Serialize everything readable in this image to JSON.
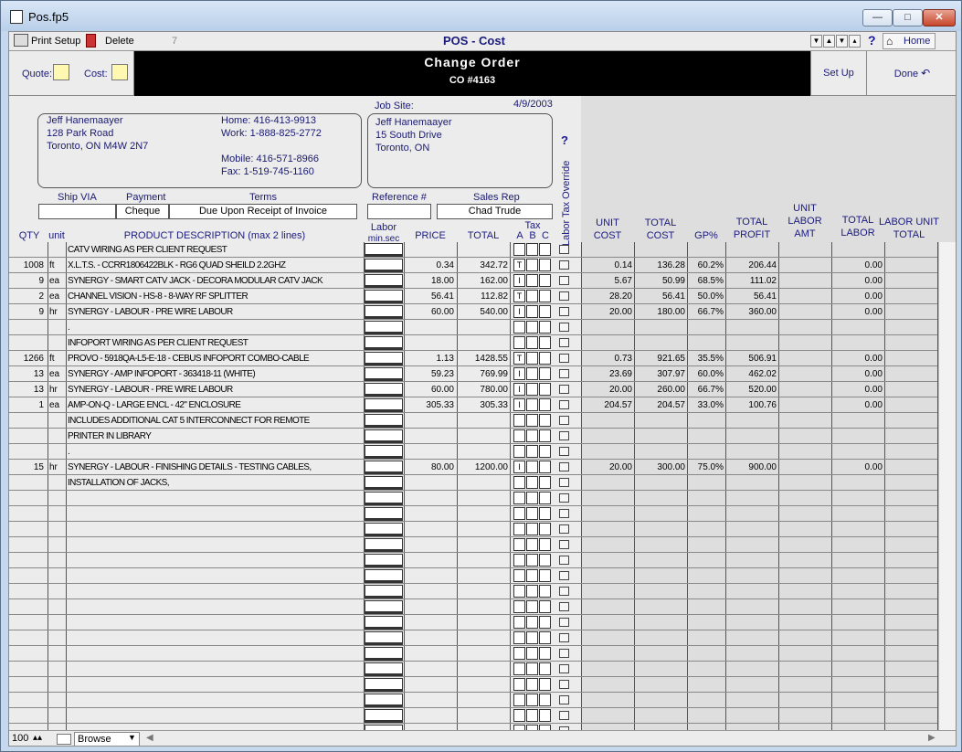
{
  "window": {
    "title": "Pos.fp5"
  },
  "toolbar": {
    "print_setup": "Print Setup",
    "delete": "Delete",
    "record_number": "7",
    "layout_title": "POS - Cost",
    "help": "?",
    "home": "Home"
  },
  "header": {
    "quote_label": "Quote:",
    "cost_label": "Cost:",
    "title": "Change Order",
    "co_number": "CO #4163",
    "setup": "Set Up",
    "done": "Done"
  },
  "customer": {
    "name": "Jeff Hanemaayer",
    "address1": "128 Park Road",
    "address2": "Toronto, ON M4W 2N7",
    "home": "Home: 416-413-9913",
    "work": "Work: 1-888-825-2772",
    "mobile": "Mobile: 416-571-8966",
    "fax": "Fax: 1-519-745-1160"
  },
  "job_site": {
    "label": "Job Site:",
    "date": "4/9/2003",
    "name": "Jeff Hanemaayer",
    "address1": "15 South Drive",
    "address2": "Toronto, ON"
  },
  "terms_row": {
    "ship_via_label": "Ship VIA",
    "ship_via": "",
    "payment_label": "Payment",
    "payment": "Cheque",
    "terms_label": "Terms",
    "terms": "Due Upon Receipt of Invoice",
    "reference_label": "Reference #",
    "reference": "",
    "sales_rep_label": "Sales Rep",
    "sales_rep": "Chad Trude"
  },
  "labor_tax_override_label": "Labor Tax Override",
  "columns": {
    "qty": "QTY",
    "unit": "unit",
    "description": "PRODUCT DESCRIPTION (max 2 lines)",
    "labor": "Labor",
    "labor_sub": "min.sec",
    "price": "PRICE",
    "total": "TOTAL",
    "tax": "Tax",
    "tax_a": "A",
    "tax_b": "B",
    "tax_c": "C",
    "unit_cost": [
      "UNIT",
      "COST"
    ],
    "total_cost": [
      "TOTAL",
      "COST"
    ],
    "gp": "GP%",
    "total_profit": [
      "TOTAL",
      "PROFIT"
    ],
    "unit_labor_amt": [
      "UNIT",
      "LABOR",
      "AMT"
    ],
    "total_labor": [
      "TOTAL",
      "LABOR"
    ],
    "labor_unit_total": [
      "LABOR UNIT",
      "TOTAL"
    ]
  },
  "rows": [
    {
      "qty": "",
      "unit": "",
      "desc": "CATV WIRING AS PER CLIENT REQUEST",
      "price": "",
      "total": "",
      "tax": "",
      "ucost": "",
      "tcost": "",
      "gp": "",
      "profit": "",
      "ulabor": "",
      "tlabor": ""
    },
    {
      "qty": "1008",
      "unit": "ft",
      "desc": "X.L.T.S. - CCRR1806422BLK - RG6 QUAD SHEILD 2.2GHZ",
      "price": "0.34",
      "total": "342.72",
      "tax": "T",
      "ucost": "0.14",
      "tcost": "136.28",
      "gp": "60.2%",
      "profit": "206.44",
      "ulabor": "",
      "tlabor": "0.00"
    },
    {
      "qty": "9",
      "unit": "ea",
      "desc": "SYNERGY - SMART CATV JACK - DECORA MODULAR CATV JACK",
      "price": "18.00",
      "total": "162.00",
      "tax": "I",
      "ucost": "5.67",
      "tcost": "50.99",
      "gp": "68.5%",
      "profit": "111.02",
      "ulabor": "",
      "tlabor": "0.00"
    },
    {
      "qty": "2",
      "unit": "ea",
      "desc": "CHANNEL VISION - HS-8 - 8-WAY RF SPLITTER",
      "price": "56.41",
      "total": "112.82",
      "tax": "T",
      "ucost": "28.20",
      "tcost": "56.41",
      "gp": "50.0%",
      "profit": "56.41",
      "ulabor": "",
      "tlabor": "0.00"
    },
    {
      "qty": "9",
      "unit": "hr",
      "desc": "SYNERGY - LABOUR - PRE WIRE LABOUR",
      "price": "60.00",
      "total": "540.00",
      "tax": "I",
      "ucost": "20.00",
      "tcost": "180.00",
      "gp": "66.7%",
      "profit": "360.00",
      "ulabor": "",
      "tlabor": "0.00"
    },
    {
      "qty": "",
      "unit": "",
      "desc": ".",
      "price": "",
      "total": "",
      "tax": "",
      "ucost": "",
      "tcost": "",
      "gp": "",
      "profit": "",
      "ulabor": "",
      "tlabor": ""
    },
    {
      "qty": "",
      "unit": "",
      "desc": "INFOPORT WIRING AS PER CLIENT REQUEST",
      "price": "",
      "total": "",
      "tax": "",
      "ucost": "",
      "tcost": "",
      "gp": "",
      "profit": "",
      "ulabor": "",
      "tlabor": ""
    },
    {
      "qty": "1266",
      "unit": "ft",
      "desc": "PROVO - 5918QA-L5-E-18 - CEBUS INFOPORT COMBO-CABLE",
      "price": "1.13",
      "total": "1428.55",
      "tax": "T",
      "ucost": "0.73",
      "tcost": "921.65",
      "gp": "35.5%",
      "profit": "506.91",
      "ulabor": "",
      "tlabor": "0.00"
    },
    {
      "qty": "13",
      "unit": "ea",
      "desc": "SYNERGY - AMP INFOPORT - 363418-11 (WHITE)",
      "price": "59.23",
      "total": "769.99",
      "tax": "I",
      "ucost": "23.69",
      "tcost": "307.97",
      "gp": "60.0%",
      "profit": "462.02",
      "ulabor": "",
      "tlabor": "0.00"
    },
    {
      "qty": "13",
      "unit": "hr",
      "desc": "SYNERGY - LABOUR - PRE WIRE LABOUR",
      "price": "60.00",
      "total": "780.00",
      "tax": "I",
      "ucost": "20.00",
      "tcost": "260.00",
      "gp": "66.7%",
      "profit": "520.00",
      "ulabor": "",
      "tlabor": "0.00"
    },
    {
      "qty": "1",
      "unit": "ea",
      "desc": "AMP-ON-Q - LARGE ENCL - 42\" ENCLOSURE",
      "price": "305.33",
      "total": "305.33",
      "tax": "I",
      "ucost": "204.57",
      "tcost": "204.57",
      "gp": "33.0%",
      "profit": "100.76",
      "ulabor": "",
      "tlabor": "0.00"
    },
    {
      "qty": "",
      "unit": "",
      "desc": "INCLUDES ADDITIONAL CAT 5 INTERCONNECT FOR REMOTE",
      "price": "",
      "total": "",
      "tax": "",
      "ucost": "",
      "tcost": "",
      "gp": "",
      "profit": "",
      "ulabor": "",
      "tlabor": ""
    },
    {
      "qty": "",
      "unit": "",
      "desc": "PRINTER IN LIBRARY",
      "price": "",
      "total": "",
      "tax": "",
      "ucost": "",
      "tcost": "",
      "gp": "",
      "profit": "",
      "ulabor": "",
      "tlabor": ""
    },
    {
      "qty": "",
      "unit": "",
      "desc": ".",
      "price": "",
      "total": "",
      "tax": "",
      "ucost": "",
      "tcost": "",
      "gp": "",
      "profit": "",
      "ulabor": "",
      "tlabor": ""
    },
    {
      "qty": "15",
      "unit": "hr",
      "desc": "SYNERGY - LABOUR - FINISHING DETAILS - TESTING CABLES,",
      "price": "80.00",
      "total": "1200.00",
      "tax": "I",
      "ucost": "20.00",
      "tcost": "300.00",
      "gp": "75.0%",
      "profit": "900.00",
      "ulabor": "",
      "tlabor": "0.00"
    },
    {
      "qty": "",
      "unit": "",
      "desc": "INSTALLATION OF JACKS,",
      "price": "",
      "total": "",
      "tax": "",
      "ucost": "",
      "tcost": "",
      "gp": "",
      "profit": "",
      "ulabor": "",
      "tlabor": ""
    }
  ],
  "empty_rows": 16,
  "statusbar": {
    "zoom": "100",
    "mode": "Browse"
  }
}
